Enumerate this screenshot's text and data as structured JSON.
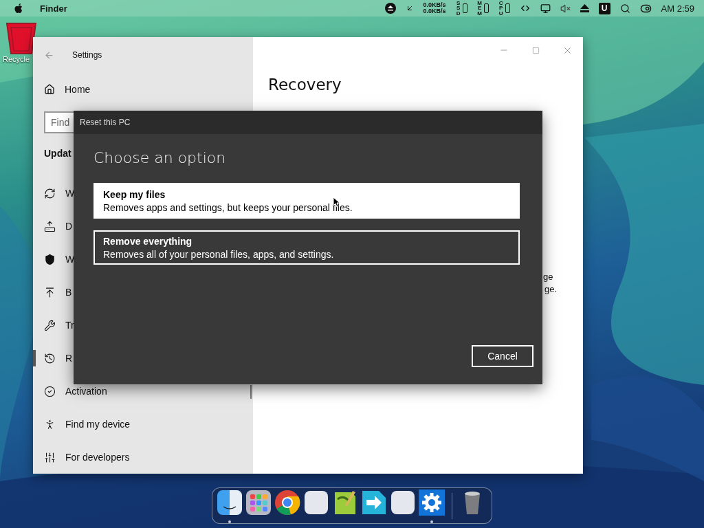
{
  "menubar": {
    "app_name": "Finder",
    "net_up": "0.0KB/s",
    "net_down": "0.0KB/s",
    "meters": [
      {
        "label": "SSD"
      },
      {
        "label": "MEM"
      },
      {
        "label": "CPU"
      }
    ],
    "key_badge": "U",
    "clock": "AM 2:59"
  },
  "desktop_icons": [
    {
      "label": "Recycle"
    }
  ],
  "settings_window": {
    "title": "Settings",
    "home": "Home",
    "search": {
      "placeholder": "Find"
    },
    "section": "Updat",
    "items": [
      {
        "kind": "sync",
        "label": "W",
        "selected": false
      },
      {
        "kind": "delivery",
        "label": "D",
        "selected": false
      },
      {
        "kind": "shield",
        "label": "W",
        "selected": false
      },
      {
        "kind": "backup",
        "label": "B",
        "selected": false
      },
      {
        "kind": "wrench",
        "label": "Tr",
        "selected": false
      },
      {
        "kind": "history",
        "label": "R",
        "selected": true
      },
      {
        "kind": "check",
        "label": "Activation",
        "selected": false
      },
      {
        "kind": "locate",
        "label": "Find my device",
        "selected": false
      },
      {
        "kind": "tools",
        "label": "For developers",
        "selected": false
      }
    ],
    "heading": "Recovery",
    "fragments": [
      "ge",
      "ge."
    ]
  },
  "dialog": {
    "title": "Reset this PC",
    "heading": "Choose an option",
    "options": [
      {
        "title": "Keep my files",
        "description": "Removes apps and settings, but keeps your personal files.",
        "selected": true
      },
      {
        "title": "Remove everything",
        "description": "Removes all of your personal files, apps, and settings.",
        "selected": false
      }
    ],
    "cancel": "Cancel"
  },
  "dock": {
    "apps": [
      {
        "kind": "finder",
        "running": true
      },
      {
        "kind": "launchpad",
        "running": false
      },
      {
        "kind": "chrome",
        "running": false
      },
      {
        "kind": "blank",
        "running": false
      },
      {
        "kind": "notepad",
        "running": false
      },
      {
        "kind": "arrow",
        "running": false
      },
      {
        "kind": "blank",
        "running": false
      },
      {
        "kind": "settings",
        "running": true
      },
      {
        "kind": "trash",
        "running": false
      }
    ]
  }
}
